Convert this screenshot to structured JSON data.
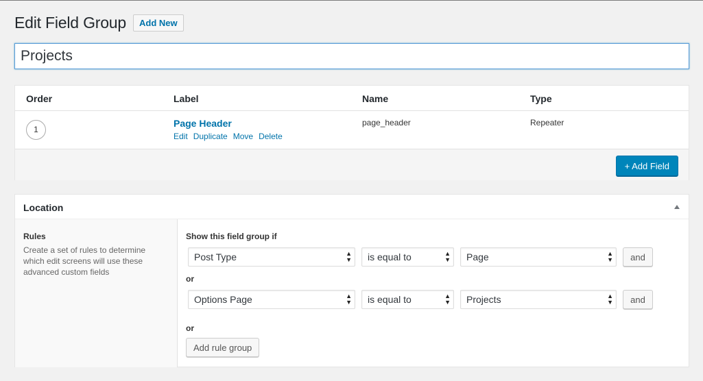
{
  "header": {
    "title": "Edit Field Group",
    "add_new_label": "Add New"
  },
  "title_input": {
    "value": "Projects"
  },
  "fields": {
    "columns": {
      "order": "Order",
      "label": "Label",
      "name": "Name",
      "type": "Type"
    },
    "rows": [
      {
        "order": "1",
        "label": "Page Header",
        "name": "page_header",
        "type": "Repeater",
        "actions": [
          "Edit",
          "Duplicate",
          "Move",
          "Delete"
        ]
      }
    ],
    "add_field_label": "+ Add Field"
  },
  "location": {
    "title": "Location",
    "rules_label": "Rules",
    "rules_description": "Create a set of rules to determine which edit screens will use these advanced custom fields",
    "show_if_label": "Show this field group if",
    "or_label": "or",
    "groups": [
      {
        "param": "Post Type",
        "operator": "is equal to",
        "value": "Page",
        "and_label": "and"
      },
      {
        "param": "Options Page",
        "operator": "is equal to",
        "value": "Projects",
        "and_label": "and"
      }
    ],
    "add_rule_group_label": "Add rule group"
  },
  "colors": {
    "accent": "#0073aa",
    "primary_button": "#0085ba",
    "background": "#f1f1f1"
  }
}
